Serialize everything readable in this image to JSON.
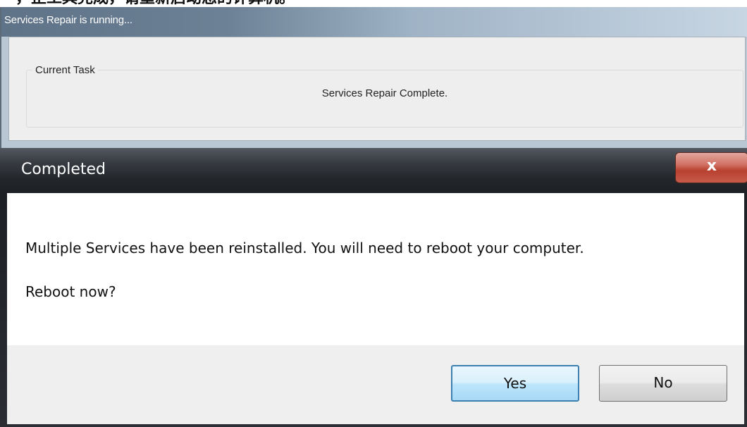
{
  "caption": "，正工具完成，请重新启动您的计算机。",
  "back_window": {
    "title": "Services Repair is running...",
    "group_label": "Current Task",
    "task_text": "Services Repair Complete."
  },
  "dialog": {
    "title": "Completed",
    "close_glyph": "x",
    "message": "Multiple Services have been reinstalled.  You will need to reboot your computer.",
    "question": "Reboot now?",
    "buttons": {
      "yes": "Yes",
      "no": "No"
    }
  },
  "colors": {
    "close_button": "#c65b4a",
    "yes_border": "#3c7fb1",
    "titlebar_dark": "#1d2024"
  }
}
